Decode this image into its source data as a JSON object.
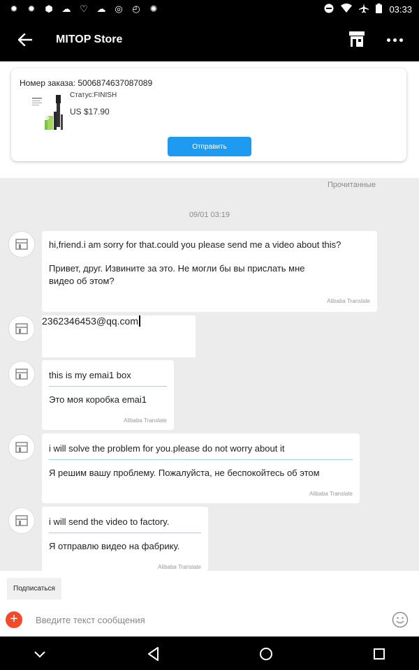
{
  "status_bar": {
    "time": "03:33"
  },
  "app_bar": {
    "title": "MITOP Store"
  },
  "order": {
    "number_label": "Номер заказа: 5006874637087089",
    "status": "Статус:FINISH",
    "price": "US $17.90",
    "send_button": "Отправить"
  },
  "chat": {
    "read_status": "Прочитанные",
    "date": "09/01 03:19",
    "messages": [
      {
        "en": "hi,friend.i am sorry for that.could you please send me a video about this?",
        "ru": "Привет, друг. Извините за это. Не могли бы вы прислать мне видео об этом?",
        "credit": "Alibaba Translate"
      },
      {
        "text": "2362346453@qq.com"
      },
      {
        "en": "this is my emai1 box",
        "ru": "Это моя коробка emai1",
        "credit": "Alibaba Translate"
      },
      {
        "en": "i will solve the problem for you.please do not worry about it",
        "ru": "Я решим вашу проблему. Пожалуйста, не беспокойтесь об этом",
        "credit": "Alibaba Translate"
      },
      {
        "en": "i will send the video to factory.",
        "ru": "Я отправлю видео на фабрику.",
        "credit": "Alibaba Translate"
      }
    ]
  },
  "bottom": {
    "subscribe_button": "Подписаться",
    "input_placeholder": "Введите текст сообщения"
  },
  "colors": {
    "accent": "#1e9bf0",
    "add_button": "#f24a2b",
    "bars": "#000000"
  }
}
